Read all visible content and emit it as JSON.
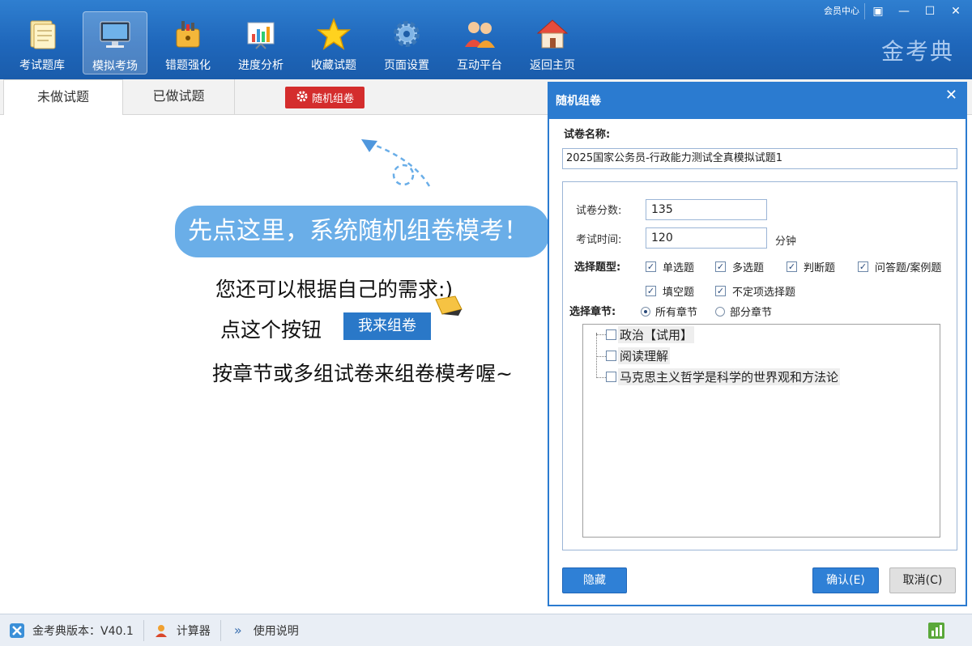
{
  "window": {
    "member_center": "会员中心",
    "brand": "金考典",
    "restore_glyph": "▣",
    "minimize_glyph": "—",
    "maximize_glyph": "☐",
    "close_glyph": "✕"
  },
  "toolbar": {
    "items": [
      {
        "label": "考试题库",
        "icon": "notebook-icon"
      },
      {
        "label": "模拟考场",
        "icon": "monitor-icon",
        "active": true
      },
      {
        "label": "错题强化",
        "icon": "lock-chart-icon"
      },
      {
        "label": "进度分析",
        "icon": "bar-chart-icon"
      },
      {
        "label": "收藏试题",
        "icon": "star-icon"
      },
      {
        "label": "页面设置",
        "icon": "gear-icon"
      },
      {
        "label": "互动平台",
        "icon": "users-icon"
      },
      {
        "label": "返回主页",
        "icon": "home-icon"
      }
    ]
  },
  "tabs": {
    "undone": "未做试题",
    "done": "已做试题",
    "random_button": "随机组卷"
  },
  "hint": {
    "banner": "先点这里，系统随机组卷模考！",
    "line1": "您还可以根据自己的需求:)",
    "line2": "点这个按钮",
    "my_compose": "我来组卷",
    "line3": "按章节或多组试卷来组卷模考喔~"
  },
  "dialog": {
    "title": "随机组卷",
    "close_glyph": "✕",
    "paper_name_label": "试卷名称:",
    "paper_name_value": "2025国家公务员-行政能力测试全真模拟试题1",
    "score_label": "试卷分数:",
    "score_value": "135",
    "time_label": "考试时间:",
    "time_value": "120",
    "time_unit": "分钟",
    "question_type_label": "选择题型:",
    "question_types": [
      {
        "label": "单选题",
        "checked": true
      },
      {
        "label": "多选题",
        "checked": true
      },
      {
        "label": "判断题",
        "checked": true
      },
      {
        "label": "问答题/案例题",
        "checked": true
      },
      {
        "label": "填空题",
        "checked": true
      },
      {
        "label": "不定项选择题",
        "checked": true
      }
    ],
    "chapter_label": "选择章节:",
    "chapter_options": [
      {
        "label": "所有章节",
        "selected": true
      },
      {
        "label": "部分章节",
        "selected": false
      }
    ],
    "chapters": [
      {
        "label": "政治【试用】"
      },
      {
        "label": "阅读理解"
      },
      {
        "label": "马克思主义哲学是科学的世界观和方法论"
      }
    ],
    "hide_button": "隐藏",
    "confirm_button": "确认(E)",
    "cancel_button": "取消(C)"
  },
  "statusbar": {
    "version": "金考典版本：V40.1",
    "calculator": "计算器",
    "manual": "使用说明",
    "chevron_glyph": "»"
  }
}
